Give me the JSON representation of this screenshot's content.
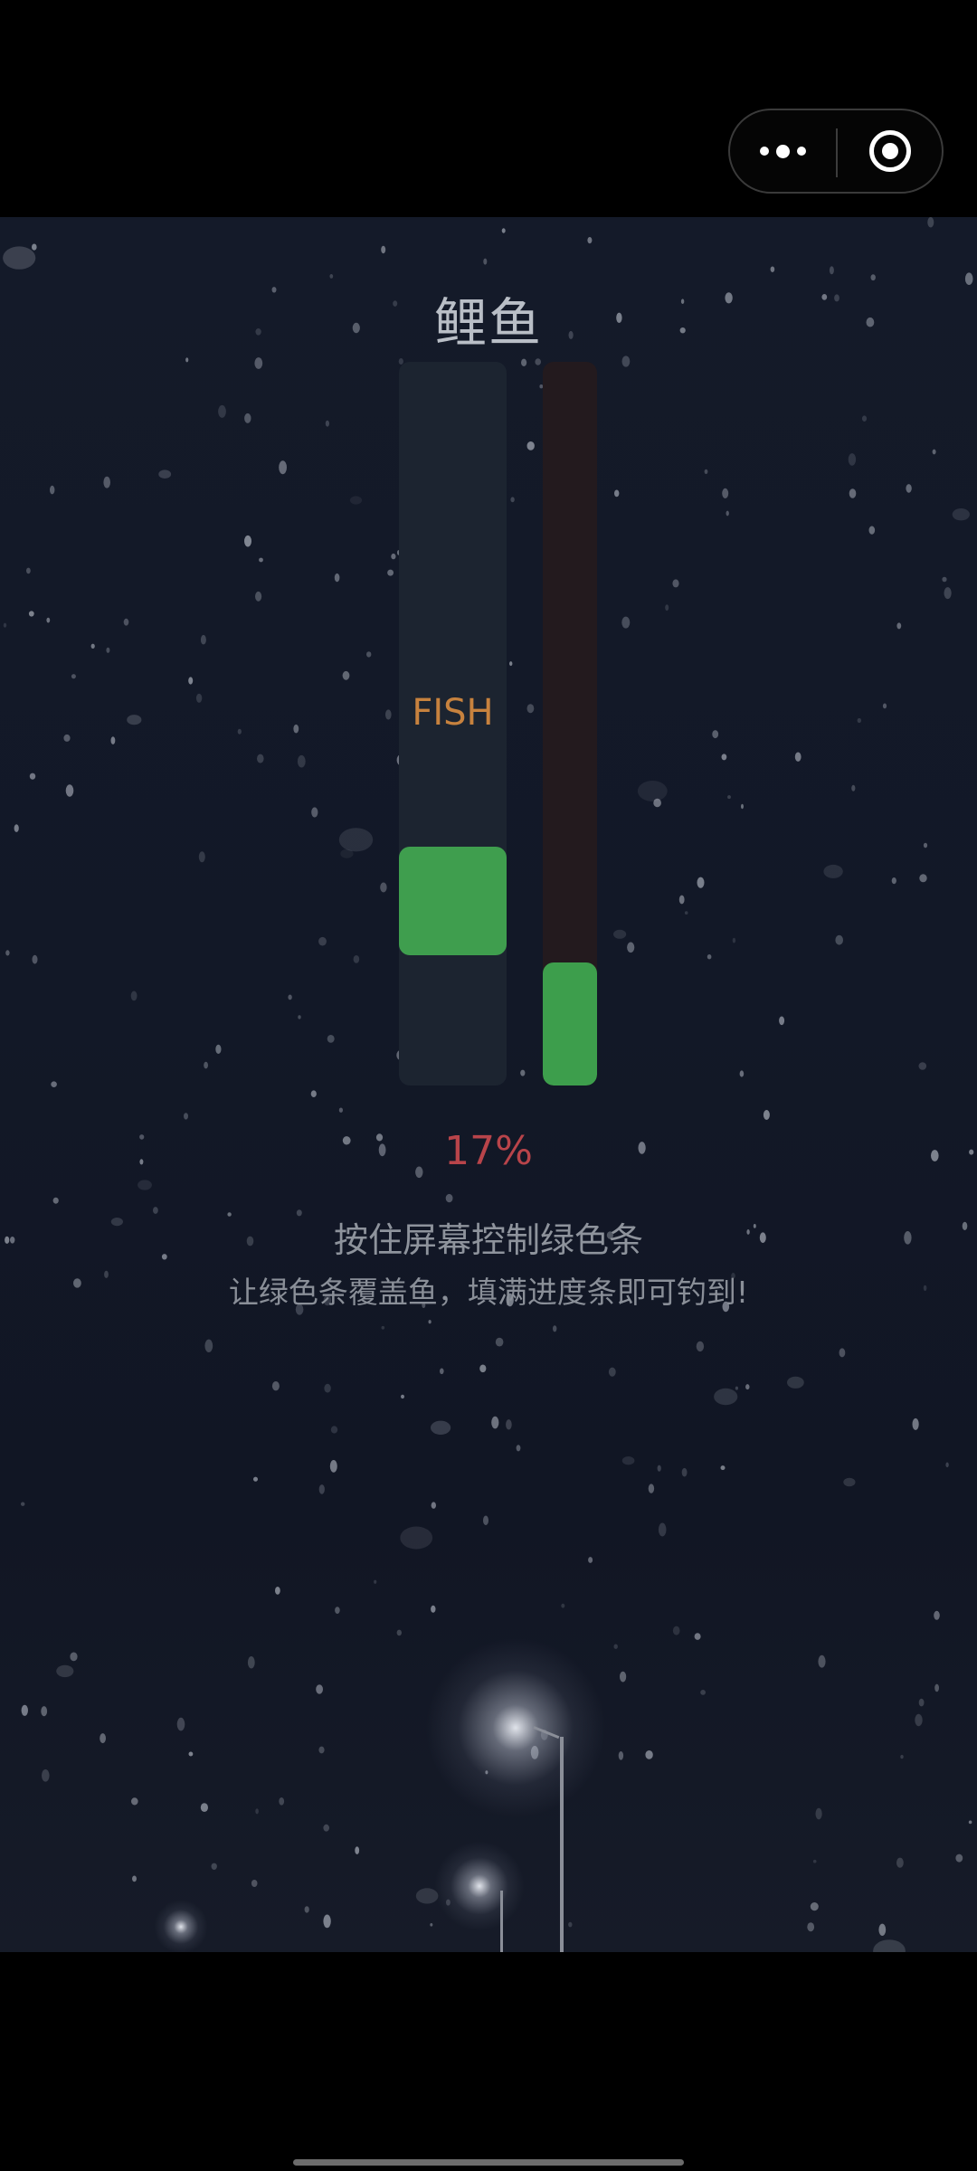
{
  "capsule": {
    "menu_icon": "more-dots-icon",
    "close_icon": "close-circle-icon"
  },
  "game": {
    "fish_name": "鲤鱼",
    "fish_label": "FISH",
    "progress_percent": 17,
    "progress_text": "17%",
    "hint_line1": "按住屏幕控制绿色条",
    "hint_line2": "让绿色条覆盖鱼，填满进度条即可钓到!"
  },
  "colors": {
    "background": "#131a28",
    "catch_bar": "#3f9e4e",
    "fish_label": "#c7823e",
    "percent": "#b8444a",
    "hint": "#8e939c"
  }
}
